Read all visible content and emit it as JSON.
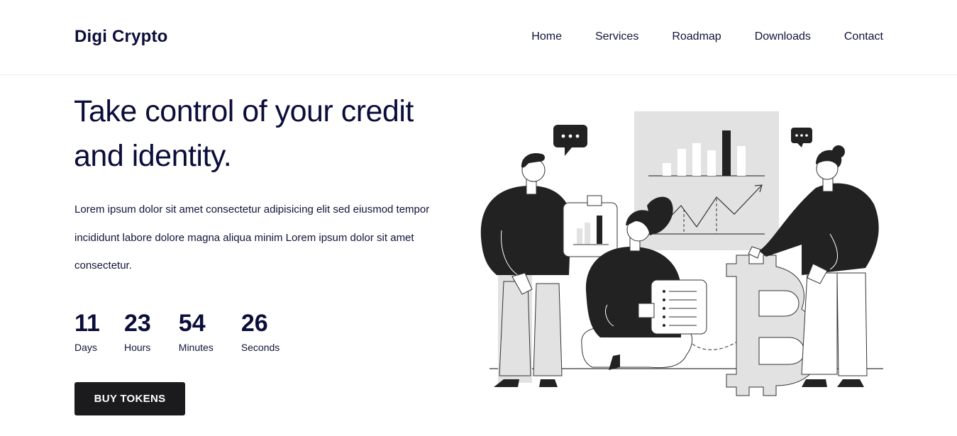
{
  "header": {
    "logo": "Digi Crypto",
    "nav": [
      "Home",
      "Services",
      "Roadmap",
      "Downloads",
      "Contact"
    ]
  },
  "hero": {
    "title": "Take control of your credit and identity.",
    "text": "Lorem ipsum dolor sit amet consectetur adipisicing elit sed eiusmod tempor incididunt labore dolore magna aliqua minim Lorem ipsum dolor sit amet consectetur.",
    "countdown": [
      {
        "value": "11",
        "label": "Days"
      },
      {
        "value": "23",
        "label": "Hours"
      },
      {
        "value": "54",
        "label": "Minutes"
      },
      {
        "value": "26",
        "label": "Seconds"
      }
    ],
    "button_label": "BUY TOKENS"
  },
  "colors": {
    "text_primary": "#0b0d3a",
    "button_bg": "#1b1b1d",
    "illustration_dark": "#222222",
    "illustration_light": "#e2e2e2"
  },
  "illustration": {
    "icon": "crypto-team-illustration"
  }
}
